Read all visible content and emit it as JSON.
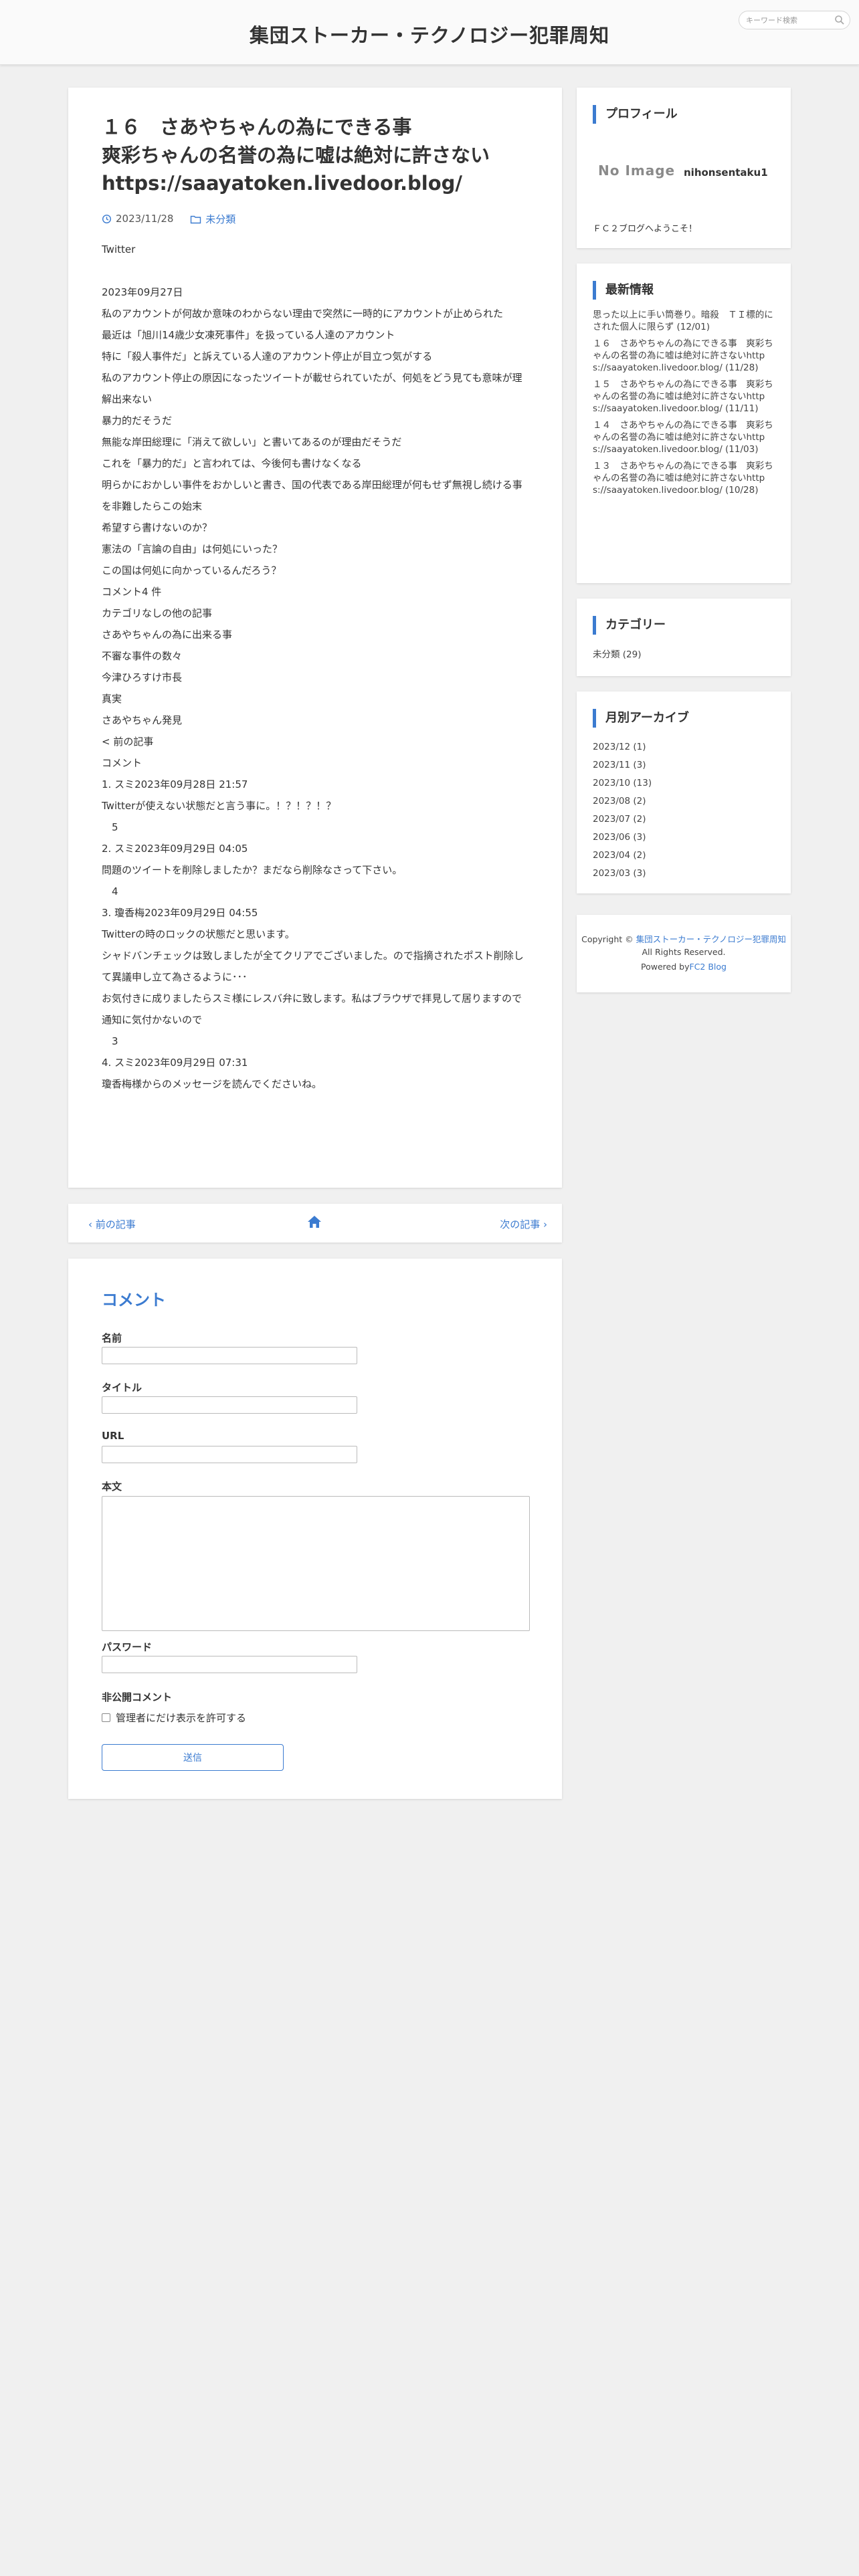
{
  "header": {
    "site_title": "集団ストーカー・テクノロジー犯罪周知",
    "search_placeholder": "キーワード検索"
  },
  "article": {
    "title_lines": [
      "１６　さあやちゃんの為にできる事",
      "爽彩ちゃんの名誉の為に嘘は絶対に許さない",
      "https://saayatoken.livedoor.blog/"
    ],
    "date": "2023/11/28",
    "category": "未分類",
    "paragraphs": [
      "Twitter",
      "",
      "2023年09月27日",
      "私のアカウントが何故か意味のわからない理由で突然に一時的にアカウントが止められた",
      "最近は「旭川14歳少女凍死事件」を扱っている人達のアカウント",
      "特に「殺人事件だ」と訴えている人達のアカウント停止が目立つ気がする",
      "私のアカウント停止の原因になったツイートが載せられていたが、何処をどう見ても意味が理解出来ない",
      "暴力的だそうだ",
      "無能な岸田総理に「消えて欲しい」と書いてあるのが理由だそうだ",
      "これを「暴力的だ」と言われては、今後何も書けなくなる",
      "明らかにおかしい事件をおかしいと書き、国の代表である岸田総理が何もせず無視し続ける事を非難したらこの始末",
      "希望すら書けないのか？",
      "憲法の「言論の自由」は何処にいった？",
      "この国は何処に向かっているんだろう？",
      "コメント4 件",
      "カテゴリなしの他の記事",
      "さあやちゃんの為に出来る事",
      "不審な事件の数々",
      "今津ひろすけ市長",
      "真実",
      "さあやちゃん発見",
      "< 前の記事",
      "コメント",
      "1. スミ2023年09月28日 21:57",
      "Twitterが使えない状態だと言う事に。！？！？！？",
      "　5",
      "2. スミ2023年09月29日 04:05",
      "問題のツイートを削除しましたか？まだなら削除なさって下さい。",
      "　4",
      "3. 瓊香梅2023年09月29日 04:55",
      "Twitterの時のロックの状態だと思います。",
      "シャドバンチェックは致しましたが全てクリアでございました。ので指摘されたポスト削除して異議申し立て為さるように･･･",
      "お気付きに成りましたらスミ様にレスバ弁に致します。私はブラウザで拝見して居りますので",
      "通知に気付かないので",
      "　3",
      "4. スミ2023年09月29日 07:31",
      "瓊香梅様からのメッセージを読んでくださいね。"
    ]
  },
  "pager": {
    "prev_label": "前の記事",
    "next_label": "次の記事"
  },
  "comment_form": {
    "heading": "コメント",
    "name_label": "名前",
    "title_label": "タイトル",
    "url_label": "URL",
    "body_label": "本文",
    "password_label": "パスワード",
    "private_label": "非公開コメント",
    "private_option": "管理者にだけ表示を許可する",
    "submit_label": "送信"
  },
  "sidebar": {
    "profile": {
      "heading": "プロフィール",
      "no_image": "No Image",
      "username": "nihonsentaku1",
      "intro": "ＦＣ２ブログへようこそ！"
    },
    "recent": {
      "heading": "最新情報",
      "items": [
        "思った以上に手い筒巻り。暗殺　ＴＩ標的にされた個人に限らず (12/01)",
        "１６　さあやちゃんの為にできる事　爽彩ちゃんの名誉の為に嘘は絶対に許さないhttps://saayatoken.livedoor.blog/ (11/28)",
        "１５　さあやちゃんの為にできる事　爽彩ちゃんの名誉の為に嘘は絶対に許さないhttps://saayatoken.livedoor.blog/ (11/11)",
        "１４　さあやちゃんの為にできる事　爽彩ちゃんの名誉の為に嘘は絶対に許さないhttps://saayatoken.livedoor.blog/ (11/03)",
        "１３　さあやちゃんの為にできる事　爽彩ちゃんの名誉の為に嘘は絶対に許さないhttps://saayatoken.livedoor.blog/ (10/28)"
      ]
    },
    "category": {
      "heading": "カテゴリー",
      "items": [
        "未分類 (29)"
      ]
    },
    "archive": {
      "heading": "月別アーカイブ",
      "items": [
        "2023/12 (1)",
        "2023/11 (3)",
        "2023/10 (13)",
        "2023/08 (2)",
        "2023/07 (2)",
        "2023/06 (3)",
        "2023/04 (2)",
        "2023/03 (3)"
      ]
    },
    "copyright": {
      "prefix": "Copyright © ",
      "site_link": "集団ストーカー・テクノロジー犯罪周知",
      "rights": "All Rights Reserved.",
      "powered_prefix": "Powered by",
      "powered_link": "FC2 Blog"
    }
  },
  "colors": {
    "accent": "#3b7bd0",
    "background": "#f0f0f0",
    "card": "#ffffff"
  }
}
